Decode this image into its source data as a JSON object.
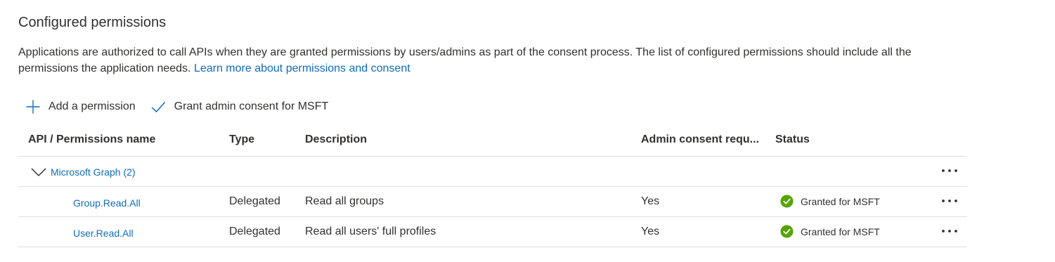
{
  "section": {
    "title": "Configured permissions",
    "description": "Applications are authorized to call APIs when they are granted permissions by users/admins as part of the consent process. The list of configured permissions should include all the permissions the application needs.",
    "learn_more_link": "Learn more about permissions and consent"
  },
  "toolbar": {
    "add_permission": {
      "label": "Add a permission",
      "icon": "plus-icon"
    },
    "grant_consent": {
      "label": "Grant admin consent for MSFT",
      "icon": "checkmark-icon"
    }
  },
  "table": {
    "columns": [
      "API / Permissions name",
      "Type",
      "Description",
      "Admin consent requ...",
      "Status"
    ],
    "group": {
      "name": "Microsoft Graph (2)",
      "expanded": true,
      "icon": "chevron-down-icon"
    },
    "rows": [
      {
        "name": "Group.Read.All",
        "type": "Delegated",
        "description": "Read all groups",
        "admin_consent": "Yes",
        "status": "Granted for MSFT",
        "status_icon": "check-circle-icon"
      },
      {
        "name": "User.Read.All",
        "type": "Delegated",
        "description": "Read all users' full profiles",
        "admin_consent": "Yes",
        "status": "Granted for MSFT",
        "status_icon": "check-circle-icon"
      }
    ]
  },
  "colors": {
    "link": "#0f6cbd",
    "text": "#323130",
    "divider": "#e1dfdd",
    "success": "#57a300"
  }
}
